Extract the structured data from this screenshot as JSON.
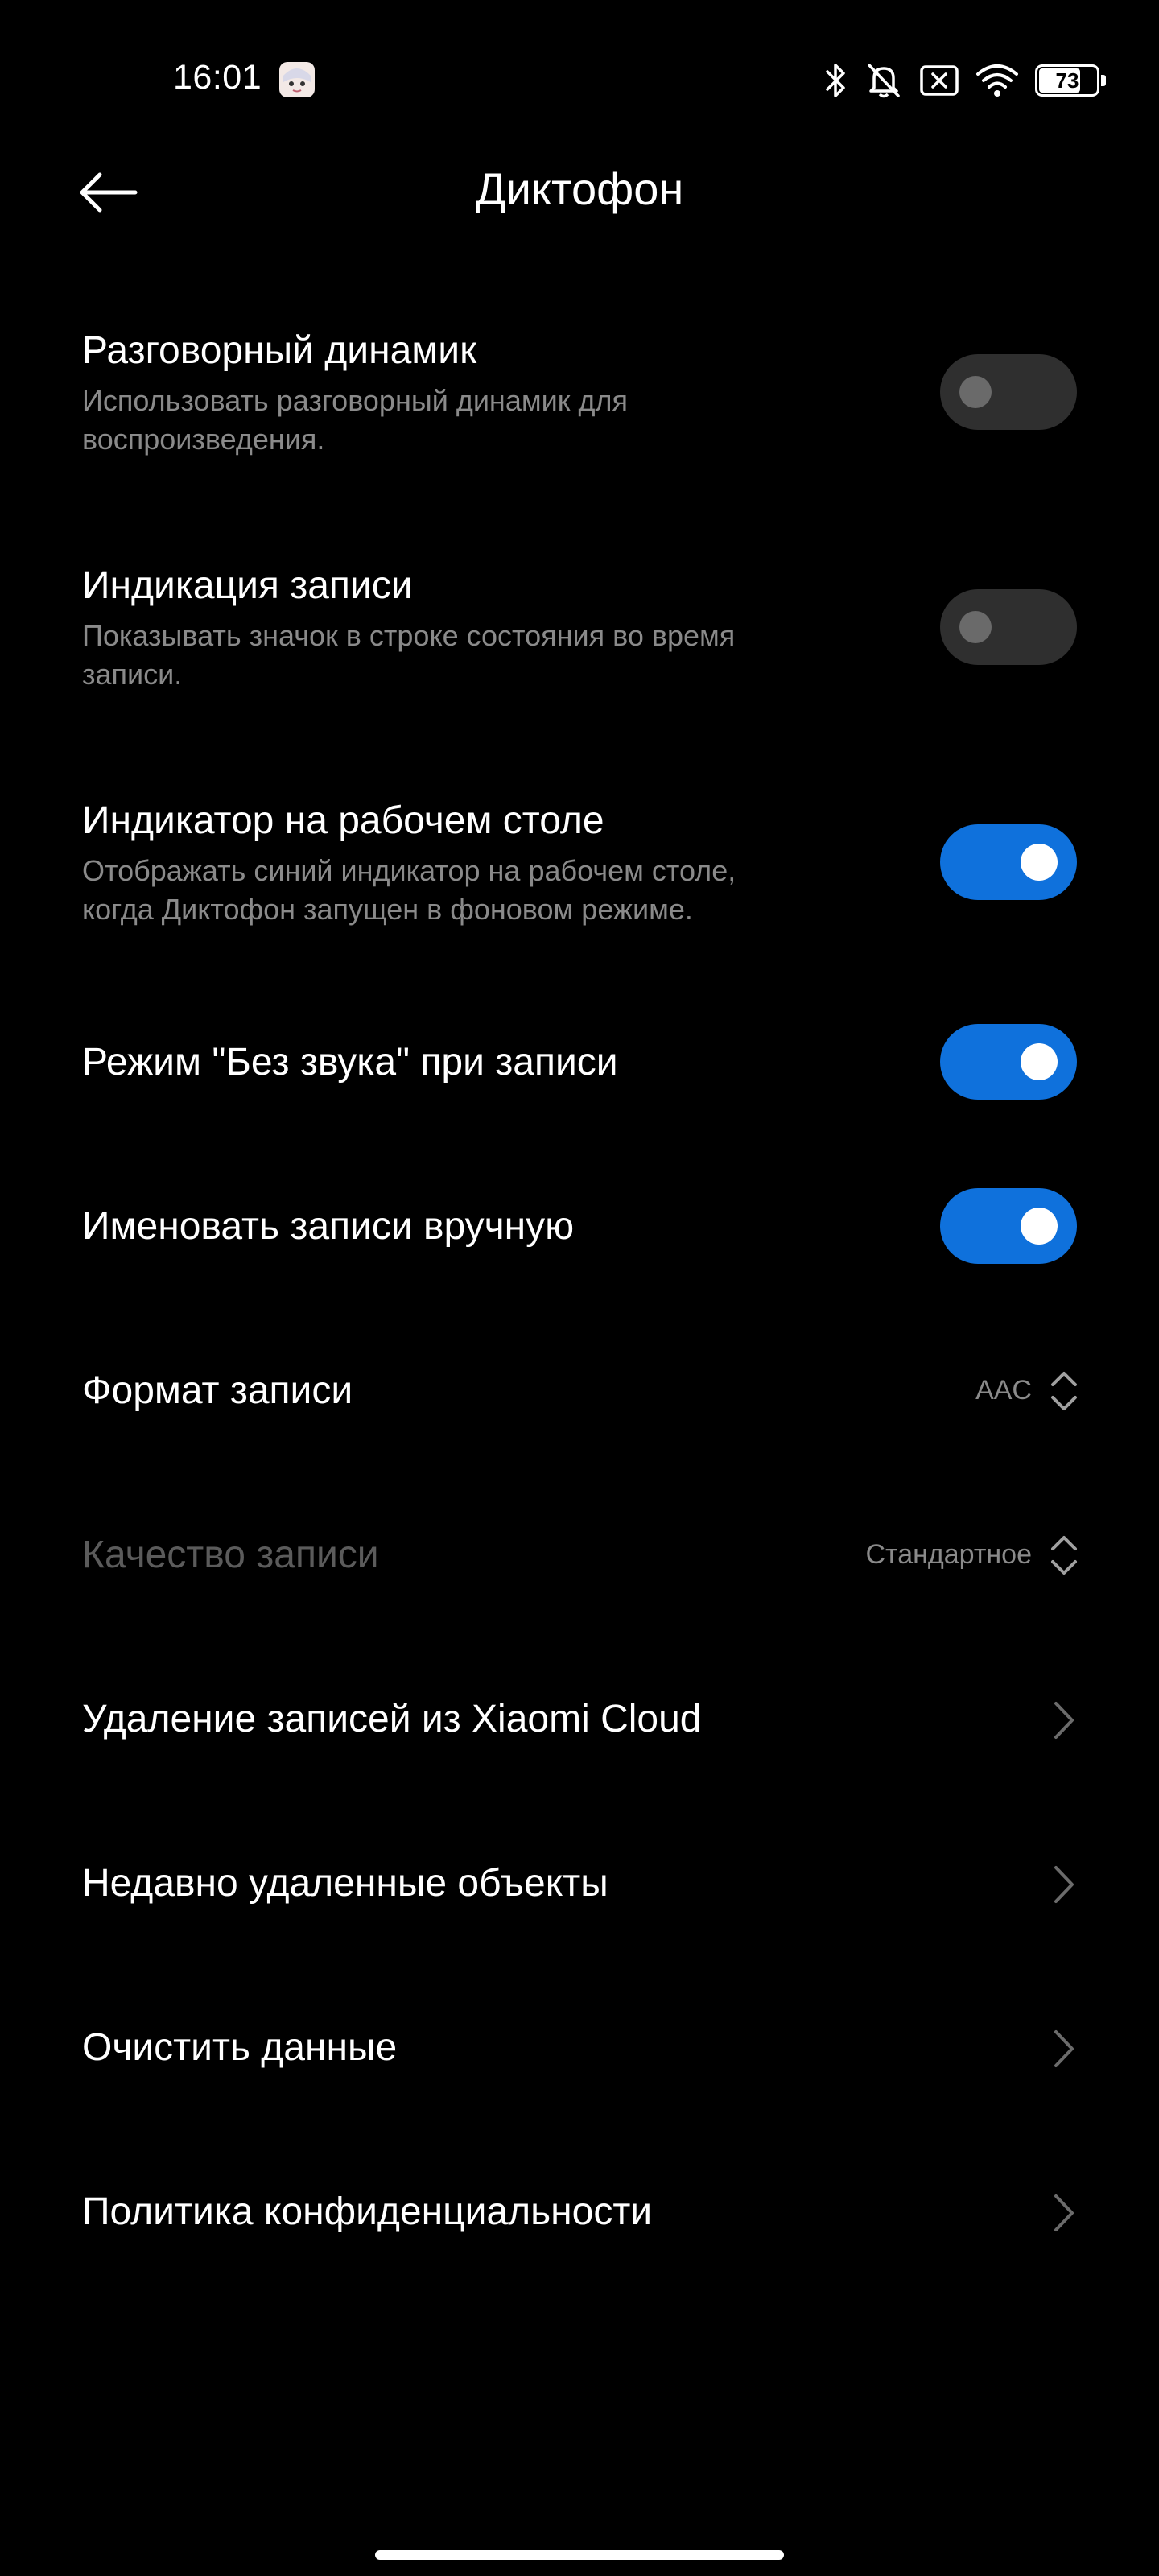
{
  "status_bar": {
    "time": "16:01",
    "battery": "73",
    "battery_level_percent": 73,
    "icons": [
      "bluetooth-icon",
      "muted-bell-icon",
      "sim-x-icon",
      "wifi-icon",
      "battery-icon"
    ]
  },
  "header": {
    "title": "Диктофон"
  },
  "settings": {
    "call_speaker": {
      "title": "Разговорный динамик",
      "subtitle_line1": "Использовать разговорный динамик для",
      "subtitle_line2": "воспроизведения.",
      "enabled": false
    },
    "recording_indicator": {
      "title": "Индикация записи",
      "subtitle_line1": "Показывать значок в строке состояния во время",
      "subtitle_line2": "записи.",
      "enabled": false
    },
    "desktop_indicator": {
      "title": "Индикатор на рабочем столе",
      "subtitle_line1": "Отображать синий индикатор на рабочем столе,",
      "subtitle_line2": "когда Диктофон запущен в фоновом режиме.",
      "enabled": true
    },
    "silent_mode": {
      "title": "Режим \"Без звука\" при записи",
      "enabled": true
    },
    "manual_naming": {
      "title": "Именовать записи вручную",
      "enabled": true
    },
    "format": {
      "title": "Формат записи",
      "value": "AAC"
    },
    "quality": {
      "title": "Качество записи",
      "value": "Стандартное"
    },
    "cloud_delete": {
      "title": "Удаление записей из Xiaomi Cloud"
    },
    "recently_deleted": {
      "title": "Недавно удаленные объекты"
    },
    "clear_data": {
      "title": "Очистить данные"
    },
    "privacy_policy": {
      "title": "Политика конфиденциальности"
    }
  },
  "colors": {
    "background": "#000000",
    "accent": "#0f71dc",
    "toggle_off": "#2f2f2f",
    "secondary_text": "#8a8a8a",
    "disabled_text": "#5b5b5b"
  }
}
